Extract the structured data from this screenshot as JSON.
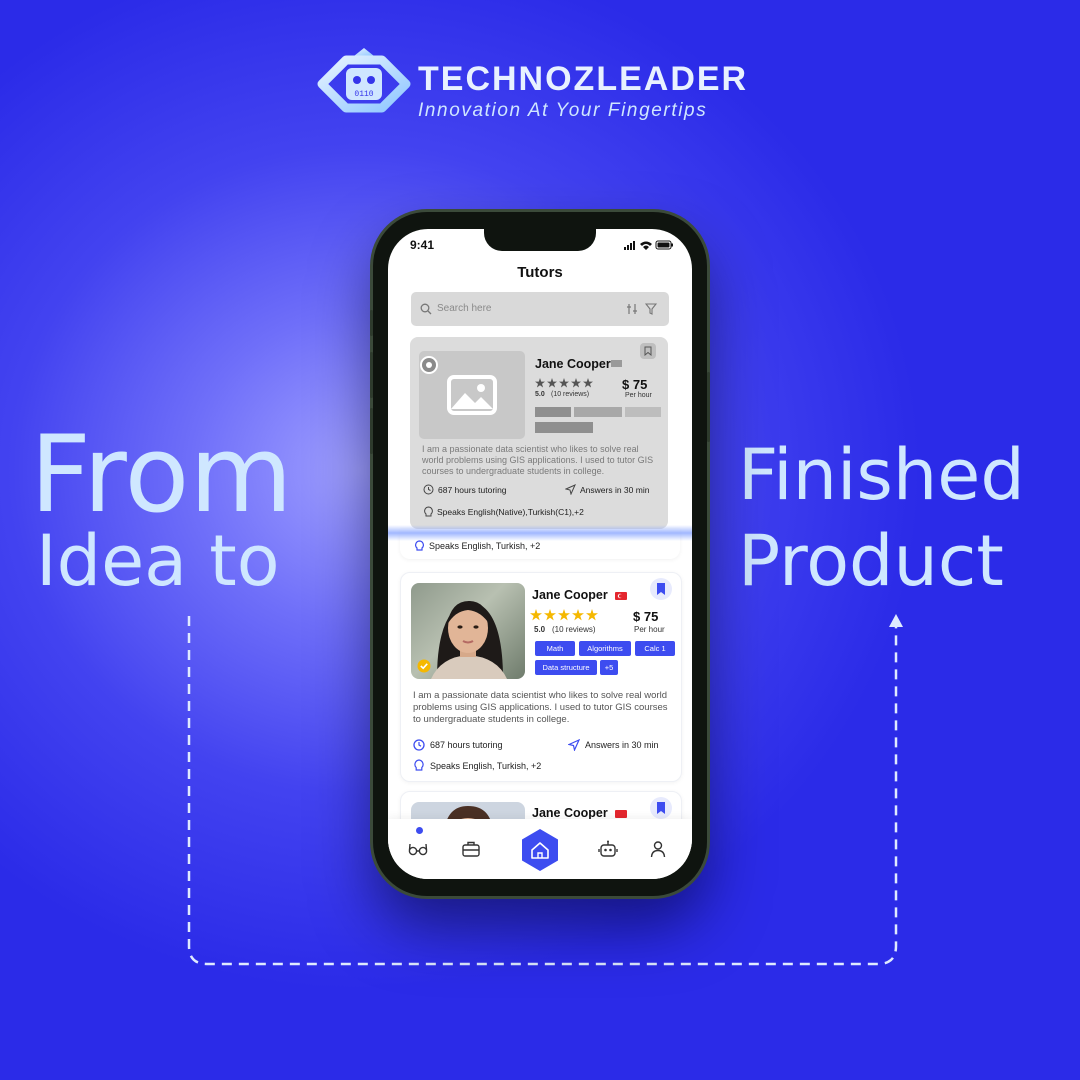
{
  "brand": {
    "name": "TECHNOZLEADER",
    "tagline": "Innovation At Your Fingertips",
    "logo_code": "0110"
  },
  "headline_left": {
    "line1": "From",
    "line2": "Idea to"
  },
  "headline_right": {
    "line1": "Finished",
    "line2": "Product"
  },
  "phone": {
    "time": "9:41",
    "title": "Tutors",
    "search": {
      "placeholder": "Search here"
    },
    "wireframe_card": {
      "name": "Jane Cooper",
      "rating": "5.0",
      "reviews": "(10 reviews)",
      "price": "$ 75",
      "per": "Per hour",
      "description": "I am a passionate data scientist who likes to solve real world problems using GIS applications. I used to tutor GIS courses to undergraduate students in college.",
      "hours": "687 hours tutoring",
      "answers": "Answers in 30 min",
      "languages": "Speaks English(Native),Turkish(C1),+2"
    },
    "peek_languages": "Speaks English, Turkish, +2",
    "card": {
      "name": "Jane Cooper",
      "rating": "5.0",
      "reviews": "(10 reviews)",
      "price": "$ 75",
      "per": "Per hour",
      "tags": [
        "Math",
        "Algorithms",
        "Calc 1",
        "Data structure",
        "+5"
      ],
      "description": "I am a passionate data scientist who likes to solve real world problems using GIS applications. I used to tutor GIS courses to undergraduate students in college.",
      "hours": "687 hours tutoring",
      "answers": "Answers in 30 min",
      "languages": "Speaks English, Turkish, +2"
    },
    "card3": {
      "name": "Jane Cooper"
    },
    "nav": [
      "glasses-icon",
      "briefcase-icon",
      "home-icon",
      "robot-icon",
      "profile-icon"
    ]
  },
  "colors": {
    "background": "#2b2be8",
    "accent": "#3d4cf0",
    "star": "#f5b800",
    "headline": "#cfe7ff"
  }
}
